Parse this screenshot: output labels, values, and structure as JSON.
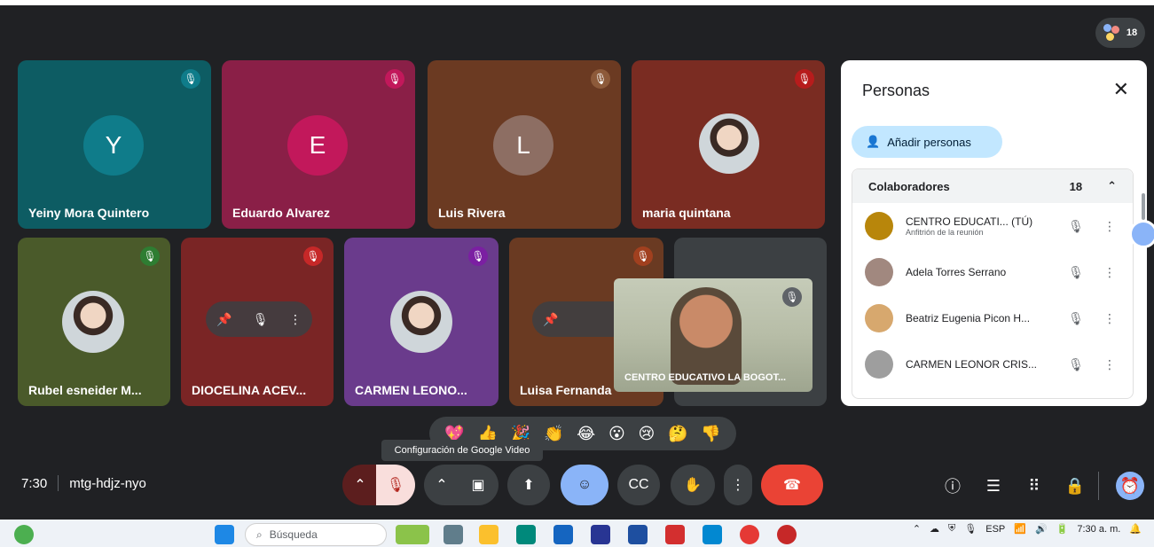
{
  "meeting": {
    "time": "7:30",
    "code": "mtg-hdjz-nyo",
    "participant_count": "18"
  },
  "tiles_top": [
    {
      "name": "Yeiny Mora Quintero",
      "initial": "Y",
      "bg": "#0d5c63",
      "avatar": "#0f7c8a",
      "mute_bg": "#0f7c8a"
    },
    {
      "name": "Eduardo Alvarez",
      "initial": "E",
      "bg": "#8a1f47",
      "avatar": "#c2185b",
      "mute_bg": "#c2185b"
    },
    {
      "name": "Luis Rivera",
      "initial": "L",
      "bg": "#6b3a22",
      "avatar": "#8d6e63",
      "mute_bg": "#8d5a3a"
    },
    {
      "name": "maria quintana",
      "initial": "",
      "bg": "#7a2c22",
      "avatar": "",
      "mute_bg": "#b71c1c"
    }
  ],
  "tiles_bottom": [
    {
      "name": "Rubel esneider M...",
      "bg": "#4a5a2a",
      "mute_bg": "#2e7d32"
    },
    {
      "name": "DIOCELINA ACEV...",
      "bg": "#7a2525",
      "mute_bg": "#c62828"
    },
    {
      "name": "CARMEN LEONO...",
      "bg": "#6a3b8c",
      "mute_bg": "#7b1fa2"
    },
    {
      "name": "Luisa Fernanda",
      "bg": "#6a3a22",
      "mute_bg": "#a1401f"
    }
  ],
  "self_view": {
    "label": "CENTRO EDUCATIVO LA BOGOT..."
  },
  "panel": {
    "title": "Personas",
    "add_label": "Añadir personas",
    "section": "Colaboradores",
    "count": "18",
    "people": [
      {
        "name": "CENTRO EDUCATI...  (TÚ)",
        "sub": "Anfitrión de la reunión",
        "color": "#b8860b"
      },
      {
        "name": "Adela Torres Serrano",
        "sub": "",
        "color": "#a1887f"
      },
      {
        "name": "Beatriz Eugenia Picon H...",
        "sub": "",
        "color": "#d7a86e"
      },
      {
        "name": "CARMEN LEONOR CRIS...",
        "sub": "",
        "color": "#9e9e9e"
      }
    ]
  },
  "reactions": [
    "💖",
    "👍",
    "🎉",
    "👏",
    "😂",
    "😮",
    "😢",
    "🤔",
    "👎"
  ],
  "tooltip": "Configuración de Google Video",
  "taskbar": {
    "search_placeholder": "Búsqueda",
    "lang": "ESP",
    "clock": "7:30 a. m."
  }
}
